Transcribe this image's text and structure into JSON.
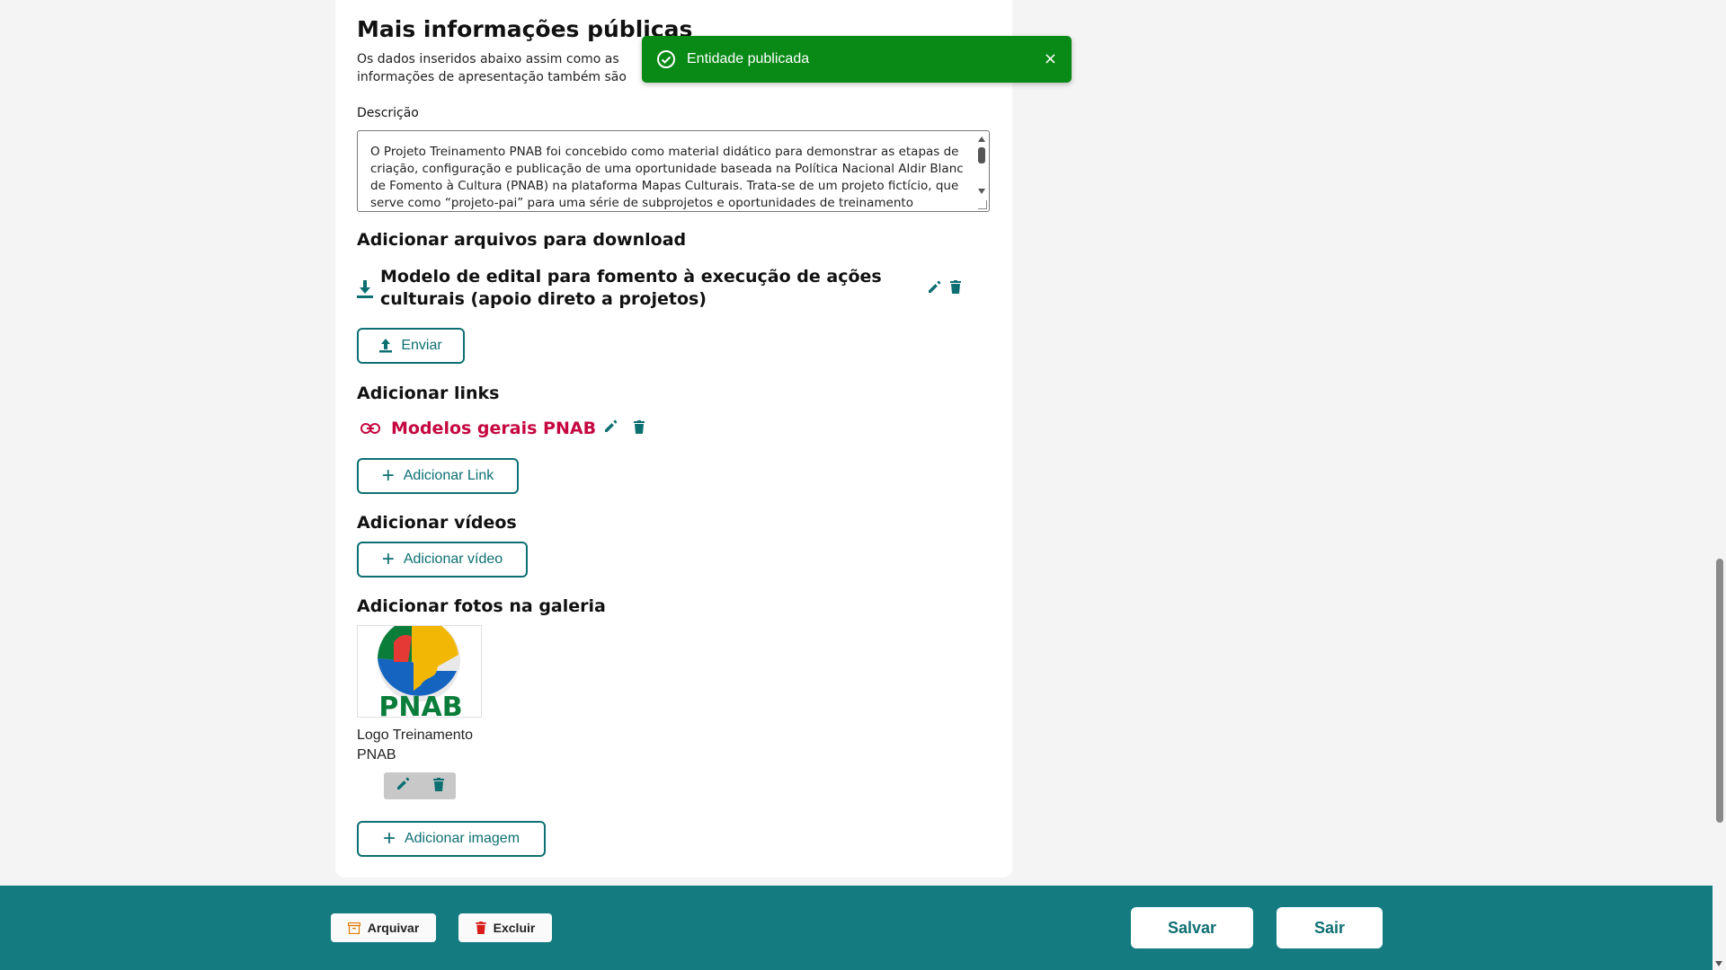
{
  "section": {
    "title": "Mais informações públicas",
    "subtitle": "Os dados inseridos abaixo assim como as informações de apresentação também são exibidos publicamente"
  },
  "description": {
    "label": "Descrição",
    "value": "O Projeto Treinamento PNAB foi concebido como material didático para demonstrar as etapas de criação, configuração e publicação de uma oportunidade baseada na Política Nacional Aldir Blanc de Fomento à Cultura (PNAB) na plataforma Mapas Culturais. Trata-se de um projeto fictício, que serve como “projeto-pai” para uma série de subprojetos e oportunidades de treinamento organizados por"
  },
  "downloads": {
    "title": "Adicionar arquivos para download",
    "files": [
      {
        "name": "Modelo de edital para fomento à execução de ações culturais (apoio direto a projetos)"
      }
    ],
    "send_label": "Enviar"
  },
  "links": {
    "title": "Adicionar links",
    "items": [
      {
        "label": "Modelos gerais PNAB"
      }
    ],
    "add_label": "Adicionar Link"
  },
  "videos": {
    "title": "Adicionar vídeos",
    "add_label": "Adicionar vídeo"
  },
  "gallery": {
    "title": "Adicionar fotos na galeria",
    "items": [
      {
        "caption": "Logo Treinamento PNAB",
        "logo_text": "PNAB"
      }
    ],
    "add_label": "Adicionar imagem"
  },
  "toast": {
    "message": "Entidade publicada",
    "close_glyph": "×",
    "color": "#098a16"
  },
  "footer": {
    "archive_label": "Arquivar",
    "delete_label": "Excluir",
    "save_label": "Salvar",
    "exit_label": "Sair",
    "color": "#147b80"
  },
  "colors": {
    "accent": "#0e6f73",
    "link": "#c5063f"
  }
}
